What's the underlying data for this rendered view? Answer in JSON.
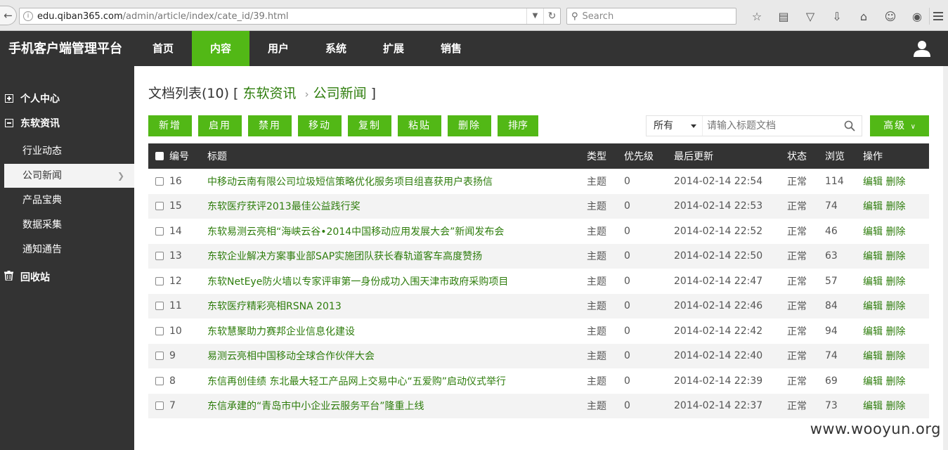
{
  "browser": {
    "url_host": "edu.qiban365.com",
    "url_path": "/admin/article/index/cate_id/39.html",
    "search_placeholder": "Search"
  },
  "app": {
    "brand": "手机客户端管理平台",
    "nav": [
      {
        "label": "首页"
      },
      {
        "label": "内容",
        "active": true
      },
      {
        "label": "用户"
      },
      {
        "label": "系统"
      },
      {
        "label": "扩展"
      },
      {
        "label": "销售"
      }
    ]
  },
  "sidebar": {
    "groups": [
      {
        "label": "个人中心",
        "icon": "plus-square-icon"
      },
      {
        "label": "东软资讯",
        "icon": "minus-square-icon"
      },
      {
        "label": "回收站",
        "icon": "trash-icon"
      }
    ],
    "items": [
      {
        "label": "行业动态"
      },
      {
        "label": "公司新闻",
        "active": true
      },
      {
        "label": "产品宝典"
      },
      {
        "label": "数据采集"
      },
      {
        "label": "通知通告"
      }
    ]
  },
  "page": {
    "title_prefix": "文档列表(10) [",
    "crumb1": "东软资讯",
    "crumb_sep": "›",
    "crumb2": "公司新闻",
    "title_suffix": "]"
  },
  "toolbar": {
    "buttons": [
      "新增",
      "启用",
      "禁用",
      "移动",
      "复制",
      "粘贴",
      "删除",
      "排序"
    ]
  },
  "filter": {
    "select_value": "所有",
    "search_placeholder": "请输入标题文档",
    "advanced_label": "高级"
  },
  "table": {
    "columns": [
      "编号",
      "标题",
      "类型",
      "优先级",
      "最后更新",
      "状态",
      "浏览",
      "操作"
    ],
    "edit_label": "编辑",
    "delete_label": "删除",
    "rows": [
      {
        "id": "16",
        "title": "中移动云南有限公司垃圾短信策略优化服务项目组喜获用户表扬信",
        "type": "主题",
        "priority": "0",
        "updated": "2014-02-14 22:54",
        "status": "正常",
        "views": "114"
      },
      {
        "id": "15",
        "title": "东软医疗获评2013最佳公益践行奖",
        "type": "主题",
        "priority": "0",
        "updated": "2014-02-14 22:53",
        "status": "正常",
        "views": "74"
      },
      {
        "id": "14",
        "title": "东软易测云亮相“海峡云谷•2014中国移动应用发展大会”新闻发布会",
        "type": "主题",
        "priority": "0",
        "updated": "2014-02-14 22:52",
        "status": "正常",
        "views": "46"
      },
      {
        "id": "13",
        "title": "东软企业解决方案事业部SAP实施团队获长春轨道客车高度赞扬",
        "type": "主题",
        "priority": "0",
        "updated": "2014-02-14 22:50",
        "status": "正常",
        "views": "63"
      },
      {
        "id": "12",
        "title": "东软NetEye防火墙以专家评审第一身份成功入围天津市政府采购项目",
        "type": "主题",
        "priority": "0",
        "updated": "2014-02-14 22:47",
        "status": "正常",
        "views": "57"
      },
      {
        "id": "11",
        "title": "东软医疗精彩亮相RSNA 2013",
        "type": "主题",
        "priority": "0",
        "updated": "2014-02-14 22:46",
        "status": "正常",
        "views": "84"
      },
      {
        "id": "10",
        "title": "东软慧聚助力赛邦企业信息化建设",
        "type": "主题",
        "priority": "0",
        "updated": "2014-02-14 22:42",
        "status": "正常",
        "views": "94"
      },
      {
        "id": "9",
        "title": "易测云亮相中国移动全球合作伙伴大会",
        "type": "主题",
        "priority": "0",
        "updated": "2014-02-14 22:40",
        "status": "正常",
        "views": "74"
      },
      {
        "id": "8",
        "title": "东信再创佳绩 东北最大轻工产品网上交易中心“五爱购”启动仪式举行",
        "type": "主题",
        "priority": "0",
        "updated": "2014-02-14 22:39",
        "status": "正常",
        "views": "69"
      },
      {
        "id": "7",
        "title": "东信承建的“青岛市中小企业云服务平台”隆重上线",
        "type": "主题",
        "priority": "0",
        "updated": "2014-02-14 22:37",
        "status": "正常",
        "views": "73"
      }
    ]
  },
  "watermark": "www.wooyun.org",
  "colors": {
    "accent": "#52b816",
    "dark": "#333333",
    "link": "#2e7d0c"
  }
}
